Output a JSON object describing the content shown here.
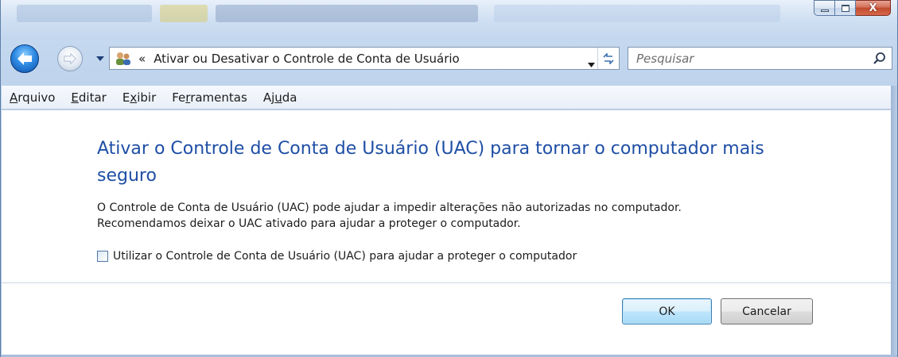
{
  "address": {
    "breadcrumb_chevron": "«",
    "path": "Ativar ou Desativar o Controle de Conta de Usuário"
  },
  "search": {
    "placeholder": "Pesquisar"
  },
  "menu": [
    {
      "pre": "",
      "accel": "A",
      "post": "rquivo"
    },
    {
      "pre": "",
      "accel": "E",
      "post": "ditar"
    },
    {
      "pre": "E",
      "accel": "x",
      "post": "ibir"
    },
    {
      "pre": "Fe",
      "accel": "r",
      "post": "ramentas"
    },
    {
      "pre": "Aj",
      "accel": "u",
      "post": "da"
    }
  ],
  "content": {
    "title": "Ativar o Controle de Conta de Usuário (UAC) para tornar o computador mais seguro",
    "description_line1": "O Controle de Conta de Usuário (UAC) pode ajudar a impedir alterações não autorizadas no computador.",
    "description_line2": "Recomendamos deixar o UAC ativado para ajudar a proteger o computador.",
    "checkbox_label": "Utilizar o Controle de Conta de Usuário (UAC) para ajudar a proteger o computador",
    "checkbox_checked": false
  },
  "buttons": {
    "ok": "OK",
    "cancel": "Cancelar"
  },
  "icons": {
    "back": "back-arrow-icon",
    "forward": "forward-arrow-icon",
    "recent": "chevron-down-icon",
    "address": "users-icon",
    "dropdown": "chevron-down-icon",
    "refresh": "refresh-icon",
    "search": "search-icon",
    "minimize": "minimize-icon",
    "maximize": "maximize-icon",
    "close": "close-icon"
  },
  "colors": {
    "title": "#1e4ea5",
    "accent": "#3c7fb1",
    "close": "#c14b2f"
  },
  "window_controls": {
    "close_glyph": "X"
  }
}
